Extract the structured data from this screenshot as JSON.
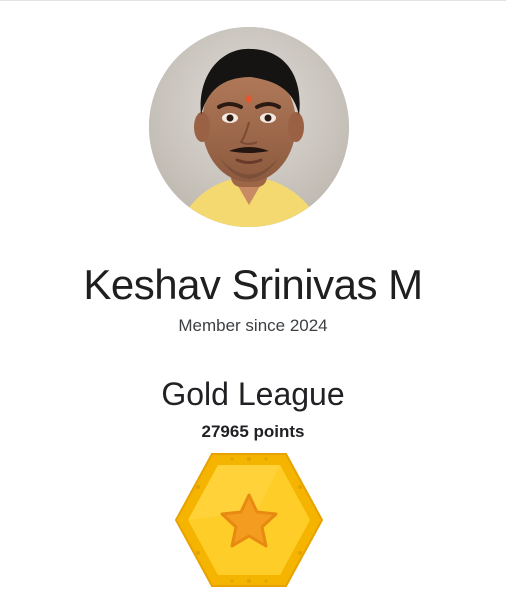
{
  "profile": {
    "name": "Keshav Srinivas M",
    "member_since": "Member since 2024",
    "avatar_icon": "profile-photo"
  },
  "league": {
    "title": "Gold League",
    "points": "27965 points",
    "badge_icon": "gold-league-star-hexagon-icon"
  },
  "colors": {
    "badge_outer": "#f7b900",
    "badge_inner": "#ffcd28",
    "badge_star": "#f39c1f",
    "text_primary": "#1f1f1f",
    "text_secondary": "#3c4043"
  }
}
